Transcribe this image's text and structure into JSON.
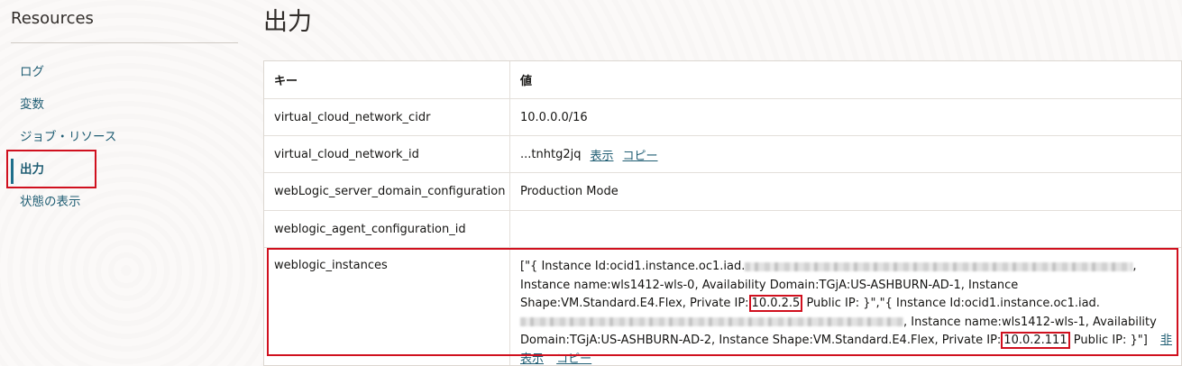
{
  "sidebar": {
    "title": "Resources",
    "items": [
      {
        "label": "ログ",
        "active": false
      },
      {
        "label": "変数",
        "active": false
      },
      {
        "label": "ジョブ・リソース",
        "active": false
      },
      {
        "label": "出力",
        "active": true
      },
      {
        "label": "状態の表示",
        "active": false
      }
    ]
  },
  "main": {
    "title": "出力",
    "table": {
      "headers": {
        "key": "キー",
        "value": "値"
      },
      "rows": [
        {
          "key": "virtual_cloud_network_cidr",
          "value": "10.0.0.0/16"
        },
        {
          "key": "virtual_cloud_network_id",
          "value": "...tnhtg2jq",
          "show_label": "表示",
          "copy_label": "コピー"
        },
        {
          "key": "webLogic_server_domain_configuration",
          "value": "Production Mode"
        },
        {
          "key": "weblogic_agent_configuration_id",
          "value": ""
        }
      ],
      "instances": {
        "key": "weblogic_instances",
        "p1": "[\"{ Instance Id:ocid1.instance.oc1.iad.",
        "p2": ", Instance name:wls1412-wls-0, Availability Domain:TGjA:US-ASHBURN-AD-1, Instance Shape:VM.Standard.E4.Flex, Private IP:",
        "ip1": "10.0.2.5",
        "p3": " Public IP: }\",\"{ Instance Id:ocid1.instance.oc1.iad.",
        "p4": ", Instance name:wls1412-wls-1, Availability Domain:TGjA:US-ASHBURN-AD-2, Instance Shape:VM.Standard.E4.Flex, Private IP:",
        "ip2": "10.0.2.111",
        "p5": " Public IP: }\"]",
        "hide_label": "非表示",
        "copy_label": "コピー"
      }
    }
  },
  "colors": {
    "accent_link": "#1f5d73",
    "highlight": "#d0101e"
  }
}
